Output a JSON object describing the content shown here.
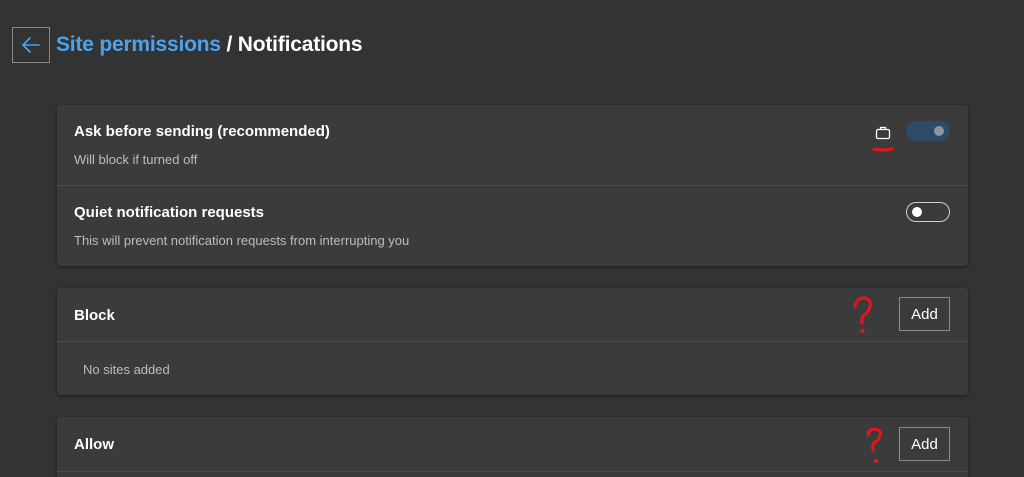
{
  "header": {
    "breadcrumb_parent": "Site permissions",
    "breadcrumb_separator": " / ",
    "breadcrumb_current": "Notifications",
    "back_icon": "arrow-left-icon"
  },
  "colors": {
    "background": "#333333",
    "card": "#3b3b3b",
    "link": "#4ba3f0",
    "annotation": "#e8141b"
  },
  "settings": {
    "ask_before_sending": {
      "title": "Ask before sending (recommended)",
      "subtitle": "Will block if turned off",
      "enabled": true,
      "managed_icon": "briefcase-icon"
    },
    "quiet_requests": {
      "title": "Quiet notification requests",
      "subtitle": "This will prevent notification requests from interrupting you",
      "enabled": false
    }
  },
  "block_section": {
    "title": "Block",
    "add_label": "Add",
    "empty_text": "No sites added",
    "annotation_icon": "question-mark-icon"
  },
  "allow_section": {
    "title": "Allow",
    "add_label": "Add",
    "annotation_icon": "question-mark-icon"
  },
  "annotations": {
    "underline_icon": "red-underline-mark"
  }
}
